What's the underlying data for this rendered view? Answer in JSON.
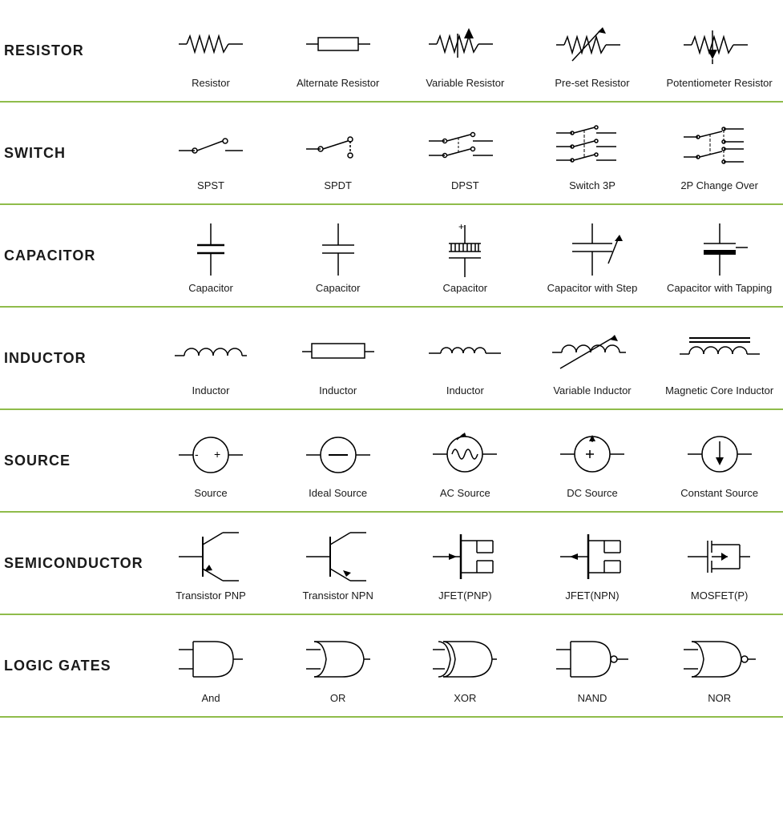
{
  "sections": [
    {
      "id": "resistor",
      "label": "RESISTOR",
      "items": [
        {
          "id": "resistor-basic",
          "name": "Resistor"
        },
        {
          "id": "resistor-alternate",
          "name": "Alternate Resistor"
        },
        {
          "id": "resistor-variable",
          "name": "Variable Resistor"
        },
        {
          "id": "resistor-preset",
          "name": "Pre-set Resistor"
        },
        {
          "id": "resistor-pot",
          "name": "Potentiometer Resistor"
        }
      ]
    },
    {
      "id": "switch",
      "label": "SWITCH",
      "items": [
        {
          "id": "switch-spst",
          "name": "SPST"
        },
        {
          "id": "switch-spdt",
          "name": "SPDT"
        },
        {
          "id": "switch-dpst",
          "name": "DPST"
        },
        {
          "id": "switch-3p",
          "name": "Switch 3P"
        },
        {
          "id": "switch-2p",
          "name": "2P Change Over"
        }
      ]
    },
    {
      "id": "capacitor",
      "label": "CAPACITOR",
      "items": [
        {
          "id": "cap-basic",
          "name": "Capacitor"
        },
        {
          "id": "cap-standard",
          "name": "Capacitor"
        },
        {
          "id": "cap-polar",
          "name": "Capacitor"
        },
        {
          "id": "cap-step",
          "name": "Capacitor with Step"
        },
        {
          "id": "cap-tapping",
          "name": "Capacitor with Tapping"
        }
      ]
    },
    {
      "id": "inductor",
      "label": "INDUCTOR",
      "items": [
        {
          "id": "ind-basic",
          "name": "Inductor"
        },
        {
          "id": "ind-alt",
          "name": "Inductor"
        },
        {
          "id": "ind-small",
          "name": "Inductor"
        },
        {
          "id": "ind-variable",
          "name": "Variable Inductor"
        },
        {
          "id": "ind-magnetic",
          "name": "Magnetic Core Inductor"
        }
      ]
    },
    {
      "id": "source",
      "label": "SOURCE",
      "items": [
        {
          "id": "source-basic",
          "name": "Source"
        },
        {
          "id": "source-ideal",
          "name": "Ideal Source"
        },
        {
          "id": "source-ac",
          "name": "AC Source"
        },
        {
          "id": "source-dc",
          "name": "DC Source"
        },
        {
          "id": "source-constant",
          "name": "Constant Source"
        }
      ]
    },
    {
      "id": "semiconductor",
      "label": "SEMICONDUCTOR",
      "items": [
        {
          "id": "semi-pnp",
          "name": "Transistor PNP"
        },
        {
          "id": "semi-npn",
          "name": "Transistor NPN"
        },
        {
          "id": "semi-jfet-pnp",
          "name": "JFET(PNP)"
        },
        {
          "id": "semi-jfet-npn",
          "name": "JFET(NPN)"
        },
        {
          "id": "semi-mosfet",
          "name": "MOSFET(P)"
        }
      ]
    },
    {
      "id": "logic",
      "label": "LOGIC GATES",
      "items": [
        {
          "id": "gate-and",
          "name": "And"
        },
        {
          "id": "gate-or",
          "name": "OR"
        },
        {
          "id": "gate-xor",
          "name": "XOR"
        },
        {
          "id": "gate-nand",
          "name": "NAND"
        },
        {
          "id": "gate-nor",
          "name": "NOR"
        }
      ]
    }
  ]
}
